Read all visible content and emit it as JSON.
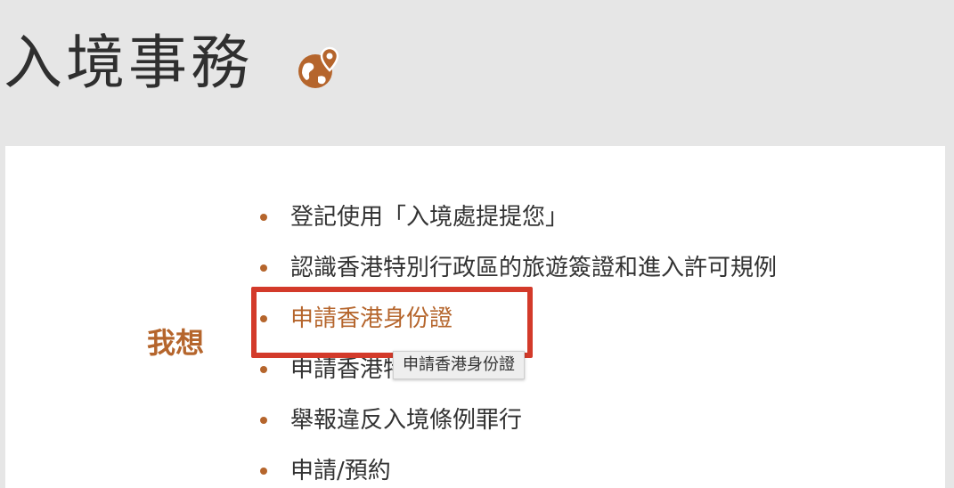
{
  "header": {
    "title": "入境事務",
    "icon": "globe-location-icon"
  },
  "sidebar_label": "我想",
  "menu": {
    "items": [
      {
        "label": "登記使用「入境處提提您」"
      },
      {
        "label": "認識香港特別行政區的旅遊簽證和進入許可規例"
      },
      {
        "label": "申請香港身份證"
      },
      {
        "label": "申請香港特區護照"
      },
      {
        "label": "舉報違反入境條例罪行"
      },
      {
        "label": "申請/預約"
      }
    ]
  },
  "tooltip": {
    "text": "申請香港身份證"
  },
  "colors": {
    "accent": "#b5652c",
    "highlight_box": "#d33a2a",
    "text": "#333333",
    "background": "#e6e6e6"
  }
}
